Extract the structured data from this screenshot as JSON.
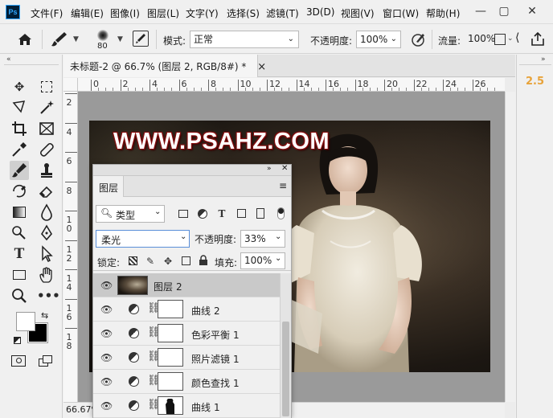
{
  "app": {
    "logo": "Ps"
  },
  "menu": [
    "文件(F)",
    "编辑(E)",
    "图像(I)",
    "图层(L)",
    "文字(Y)",
    "选择(S)",
    "滤镜(T)",
    "3D(D)",
    "视图(V)",
    "窗口(W)",
    "帮助(H)"
  ],
  "window_controls": {
    "minimize": "—",
    "restore": "▢",
    "close": "✕"
  },
  "options": {
    "brush_size": "80",
    "mode_label": "模式:",
    "mode_value": "正常",
    "opacity_label": "不透明度:",
    "opacity_value": "100%",
    "flow_label": "流量:",
    "flow_value": "100%"
  },
  "document": {
    "tab_title": "未标题-2 @ 66.7% (图层 2, RGB/8#) *",
    "tab_close": "×",
    "zoom": "66.67%",
    "watermark": "WWW.PSAHZ.COM",
    "ruler_top": [
      "0",
      "2",
      "4",
      "6",
      "8",
      "10",
      "12",
      "14",
      "16",
      "18",
      "20",
      "22",
      "24",
      "26"
    ],
    "ruler_left": [
      "2",
      "4",
      "6",
      "8",
      "1\n0",
      "1\n2",
      "1\n4",
      "1\n6",
      "1\n8"
    ]
  },
  "right_panel": {
    "value": "2.5"
  },
  "layers_panel": {
    "title": "图层",
    "filter_label": "类型",
    "blend_mode": "柔光",
    "opacity_label": "不透明度:",
    "opacity_value": "33%",
    "lock_label": "锁定:",
    "fill_label": "填充:",
    "fill_value": "100%",
    "layers": [
      {
        "name": "图层",
        "num": "2",
        "type": "pixel",
        "selected": true
      },
      {
        "name": "曲线",
        "num": "2",
        "type": "adjustment",
        "selected": false
      },
      {
        "name": "色彩平衡",
        "num": "1",
        "type": "adjustment",
        "selected": false
      },
      {
        "name": "照片滤镜",
        "num": "1",
        "type": "adjustment",
        "selected": false
      },
      {
        "name": "颜色查找",
        "num": "1",
        "type": "adjustment",
        "selected": false
      },
      {
        "name": "曲线",
        "num": "1",
        "type": "adjustment-masked",
        "selected": false
      }
    ]
  },
  "colors": {
    "accent_value": "#e8a33a",
    "logo_bg": "#001e36",
    "logo_fg": "#31a8ff",
    "watermark_stroke": "#8b1010"
  }
}
